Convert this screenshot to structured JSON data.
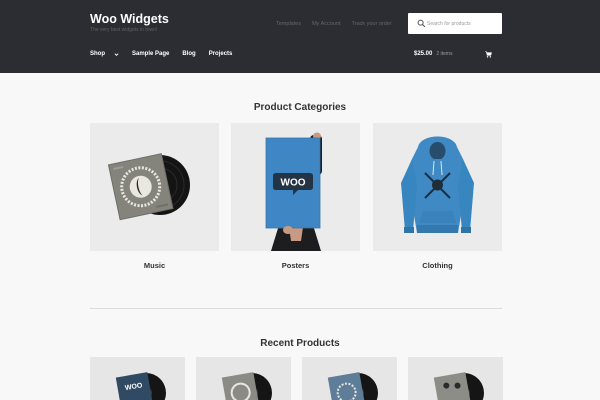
{
  "site": {
    "title": "Woo Widgets",
    "tagline": "The very best widgets in town!"
  },
  "secondary_nav": [
    "Templates",
    "My Account",
    "Track your order"
  ],
  "search": {
    "placeholder": "Search for products"
  },
  "main_nav": [
    {
      "label": "Shop",
      "has_dropdown": true
    },
    {
      "label": "Sample Page"
    },
    {
      "label": "Blog"
    },
    {
      "label": "Projects"
    }
  ],
  "cart": {
    "amount": "$25.00",
    "items": "2 items",
    "icon": "cart-icon"
  },
  "categories": {
    "title": "Product Categories",
    "items": [
      {
        "label": "Music",
        "image": "vinyl-record"
      },
      {
        "label": "Posters",
        "image": "woo-poster"
      },
      {
        "label": "Clothing",
        "image": "blue-hoodie"
      }
    ]
  },
  "recent_products": {
    "title": "Recent Products",
    "items": [
      {
        "image": "woo-album"
      },
      {
        "image": "album"
      },
      {
        "image": "album"
      },
      {
        "image": "album"
      }
    ]
  },
  "colors": {
    "header_bg": "#2c2d33",
    "page_bg": "#f8f8f8",
    "poster_blue": "#3f86c4",
    "hoodie_blue": "#3f89c4"
  }
}
